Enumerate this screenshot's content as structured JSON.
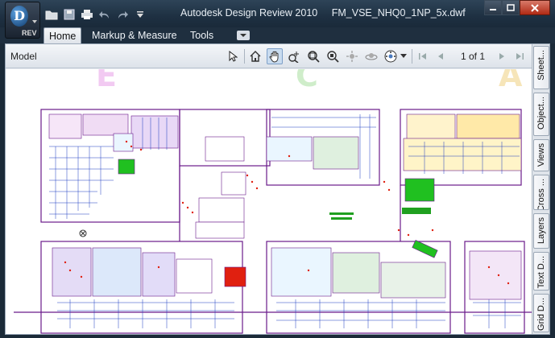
{
  "window": {
    "app_name": "Autodesk Design Review 2010",
    "file_name": "FM_VSE_NHQ0_1NP_5x.dwf",
    "app_button_logo": "D",
    "app_button_badge": "REV",
    "minimize_icon": "minimize-icon",
    "maximize_icon": "maximize-icon",
    "close_icon": "close-icon"
  },
  "quick_access": [
    "open-folder-icon",
    "save-icon",
    "print-icon",
    "undo-icon",
    "redo-icon",
    "customize-dropdown-icon"
  ],
  "ribbon": {
    "tabs": [
      {
        "label": "Home",
        "active": true
      },
      {
        "label": "Markup & Measure",
        "active": false
      },
      {
        "label": "Tools",
        "active": false
      }
    ]
  },
  "toolbar": {
    "model_label": "Model",
    "tools": [
      "select-icon",
      "home-view-icon",
      "pan-hand-icon",
      "zoom-icon",
      "zoom-rectangle-icon",
      "fit-to-window-icon",
      "orbit-icon",
      "turntable-icon",
      "steering-wheel-icon",
      "dropdown-icon"
    ],
    "page_indicator": "1 of 1",
    "nav": [
      "first-page-icon",
      "previous-page-icon",
      "next-page-icon",
      "last-page-icon"
    ]
  },
  "side_tabs": [
    {
      "label": "Sheet..."
    },
    {
      "label": "Object..."
    },
    {
      "label": "Views"
    },
    {
      "label": "Cross ..."
    },
    {
      "label": "Layers"
    },
    {
      "label": "Text D..."
    },
    {
      "label": "Grid D..."
    }
  ],
  "canvas": {
    "background_letters": [
      "E",
      "C",
      "A"
    ]
  },
  "colors": {
    "titlebar": "#1e3042",
    "canvas": "#ffffff",
    "plan_outline": "#6a1a8a",
    "highlight_red": "#e02010",
    "highlight_green": "#20c020"
  }
}
